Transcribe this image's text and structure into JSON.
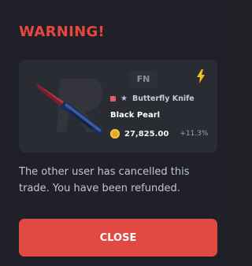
{
  "modal": {
    "title": "WARNING!",
    "message": "The other user has cancelled this trade. You have been refunded.",
    "close_label": "CLOSE"
  },
  "item": {
    "wear": "FN",
    "weapon_name": "Butterfly Knife",
    "variant": "Black Pearl",
    "price": "27,825.00",
    "change": "+11.3%",
    "rarity_color": "#e25d6b",
    "icons": [
      "knife-image",
      "lightning-icon",
      "star-icon",
      "coin-icon"
    ]
  },
  "colors": {
    "accent": "#e04a43",
    "title": "#e8463f",
    "background": "#202128",
    "card": "#2a2c33",
    "bolt": "#f1c21b",
    "coin": "#e6a91e"
  }
}
